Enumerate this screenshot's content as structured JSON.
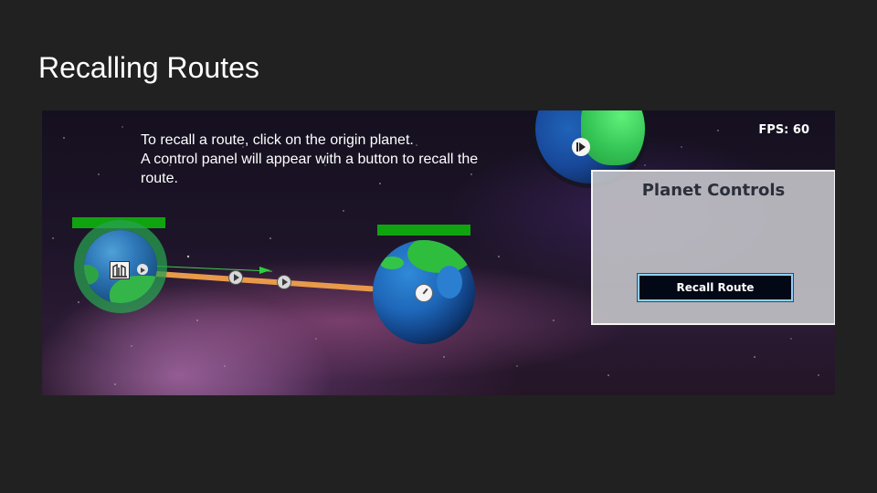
{
  "slide": {
    "title": "Recalling Routes"
  },
  "game": {
    "instructions": [
      "To recall a route, click on the origin planet.",
      "A control panel will appear with a button to recall the",
      "route."
    ],
    "fps_label": "FPS: 60",
    "planet_controls": {
      "title": "Planet Controls",
      "recall_button_label": "Recall Route"
    },
    "colors": {
      "health_bar": "#10a310",
      "route_line": "#e89a4a",
      "button_border": "#8fd0ff"
    },
    "icons": [
      "building-icon",
      "launch-icon",
      "dial-icon",
      "play-icon",
      "ship-icon"
    ]
  }
}
